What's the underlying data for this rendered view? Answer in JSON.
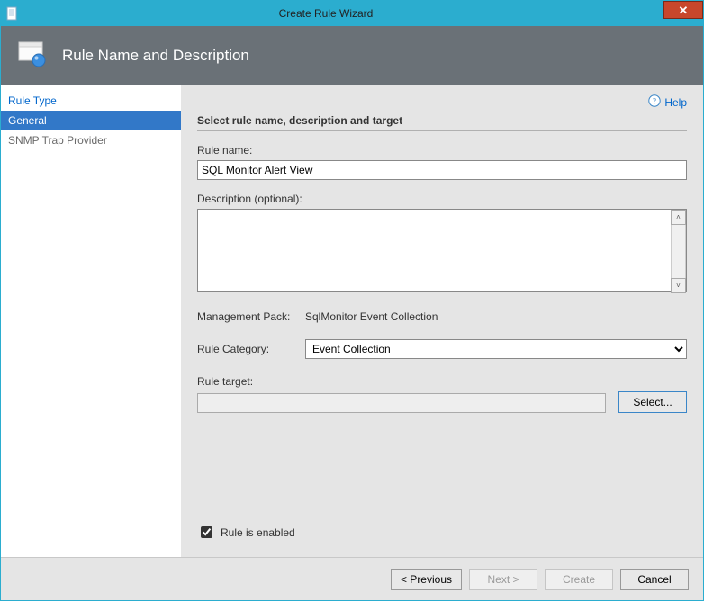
{
  "window": {
    "title": "Create Rule Wizard"
  },
  "banner": {
    "heading": "Rule Name and Description"
  },
  "sidebar": {
    "items": [
      {
        "label": "Rule Type"
      },
      {
        "label": "General"
      },
      {
        "label": "SNMP Trap Provider"
      }
    ]
  },
  "help": {
    "label": "Help"
  },
  "section": {
    "heading": "Select rule name, description and target"
  },
  "fields": {
    "rule_name_label": "Rule name:",
    "rule_name_value": "SQL Monitor Alert View",
    "description_label": "Description (optional):",
    "description_value": "",
    "management_pack_label": "Management Pack:",
    "management_pack_value": "SqlMonitor Event Collection",
    "rule_category_label": "Rule Category:",
    "rule_category_value": "Event Collection",
    "rule_target_label": "Rule target:",
    "rule_target_value": "",
    "select_button": "Select...",
    "rule_enabled_label": "Rule is enabled",
    "rule_enabled_checked": true
  },
  "footer": {
    "previous": "< Previous",
    "next": "Next >",
    "create": "Create",
    "cancel": "Cancel"
  }
}
